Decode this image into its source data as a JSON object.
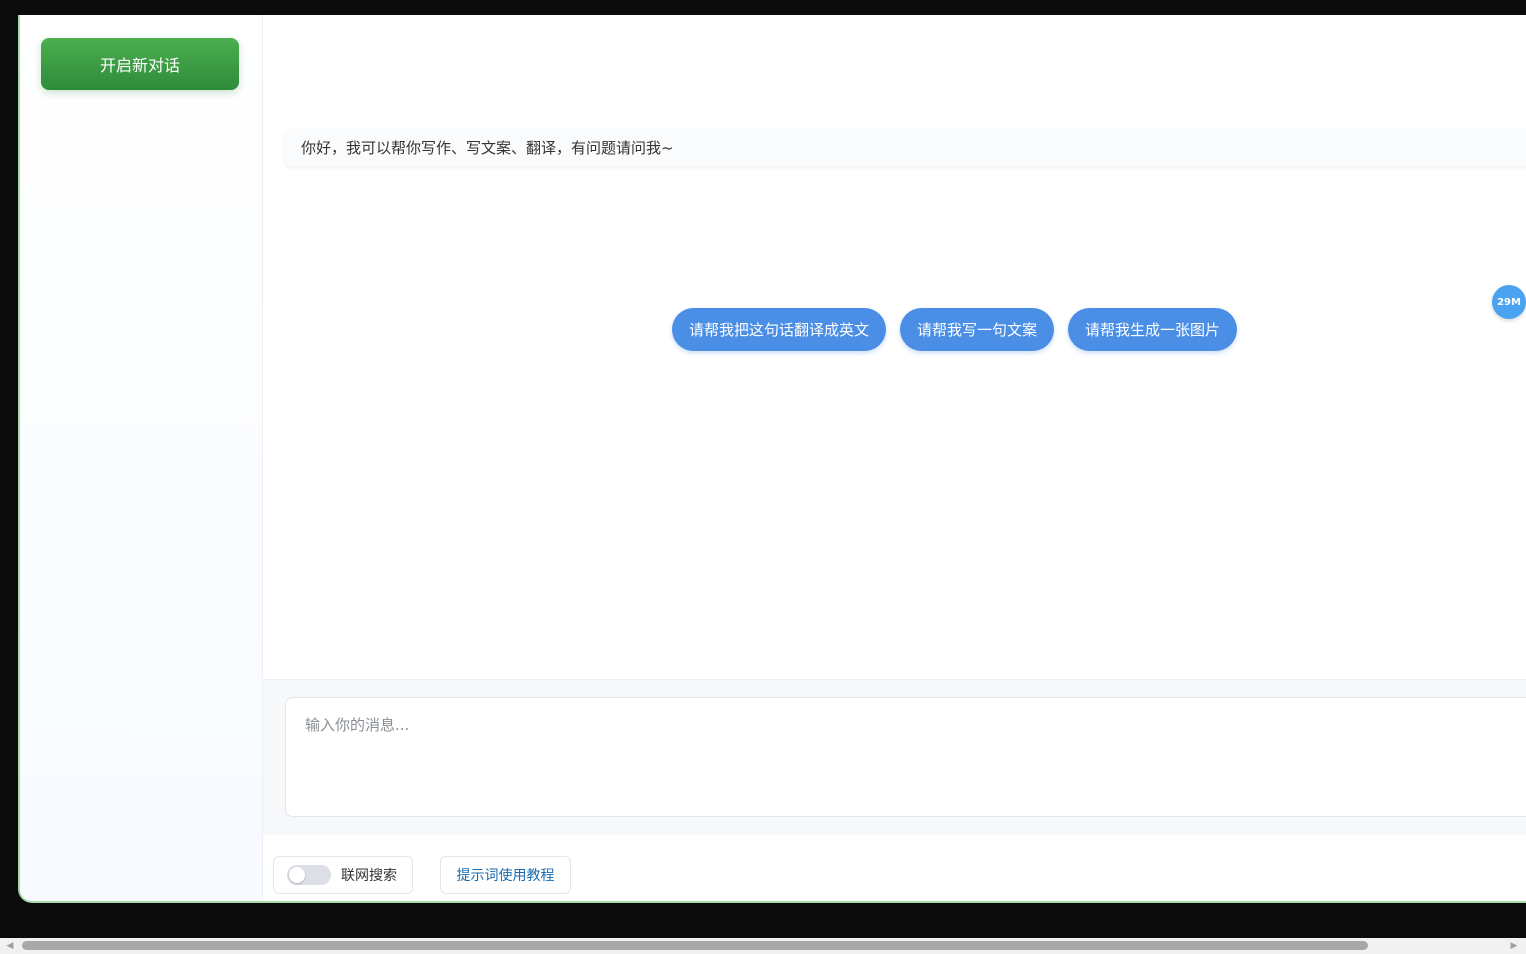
{
  "sidebar": {
    "new_chat_label": "开启新对话"
  },
  "chat": {
    "greeting": "你好，我可以帮你写作、写文案、翻译，有问题请问我~",
    "suggestions": [
      {
        "label": "请帮我把这句话翻译成英文"
      },
      {
        "label": "请帮我写一句文案"
      },
      {
        "label": "请帮我生成一张图片"
      }
    ],
    "memory_badge": "29M"
  },
  "composer": {
    "placeholder": "输入你的消息...",
    "value": ""
  },
  "toolbar": {
    "web_search_label": "联网搜索",
    "web_search_enabled": false,
    "tutorial_label": "提示词使用教程"
  },
  "colors": {
    "new_chat_gradient_start": "#4caf50",
    "new_chat_gradient_end": "#2e8b3a",
    "suggestion_bg": "#4a8ee6",
    "badge_bg": "#4aa3f0",
    "tutorial_text": "#1a6bb0",
    "frame_border": "#a7dcaa"
  },
  "icons": {
    "scroll_left": "triangle-left-icon",
    "scroll_right": "triangle-right-icon"
  }
}
